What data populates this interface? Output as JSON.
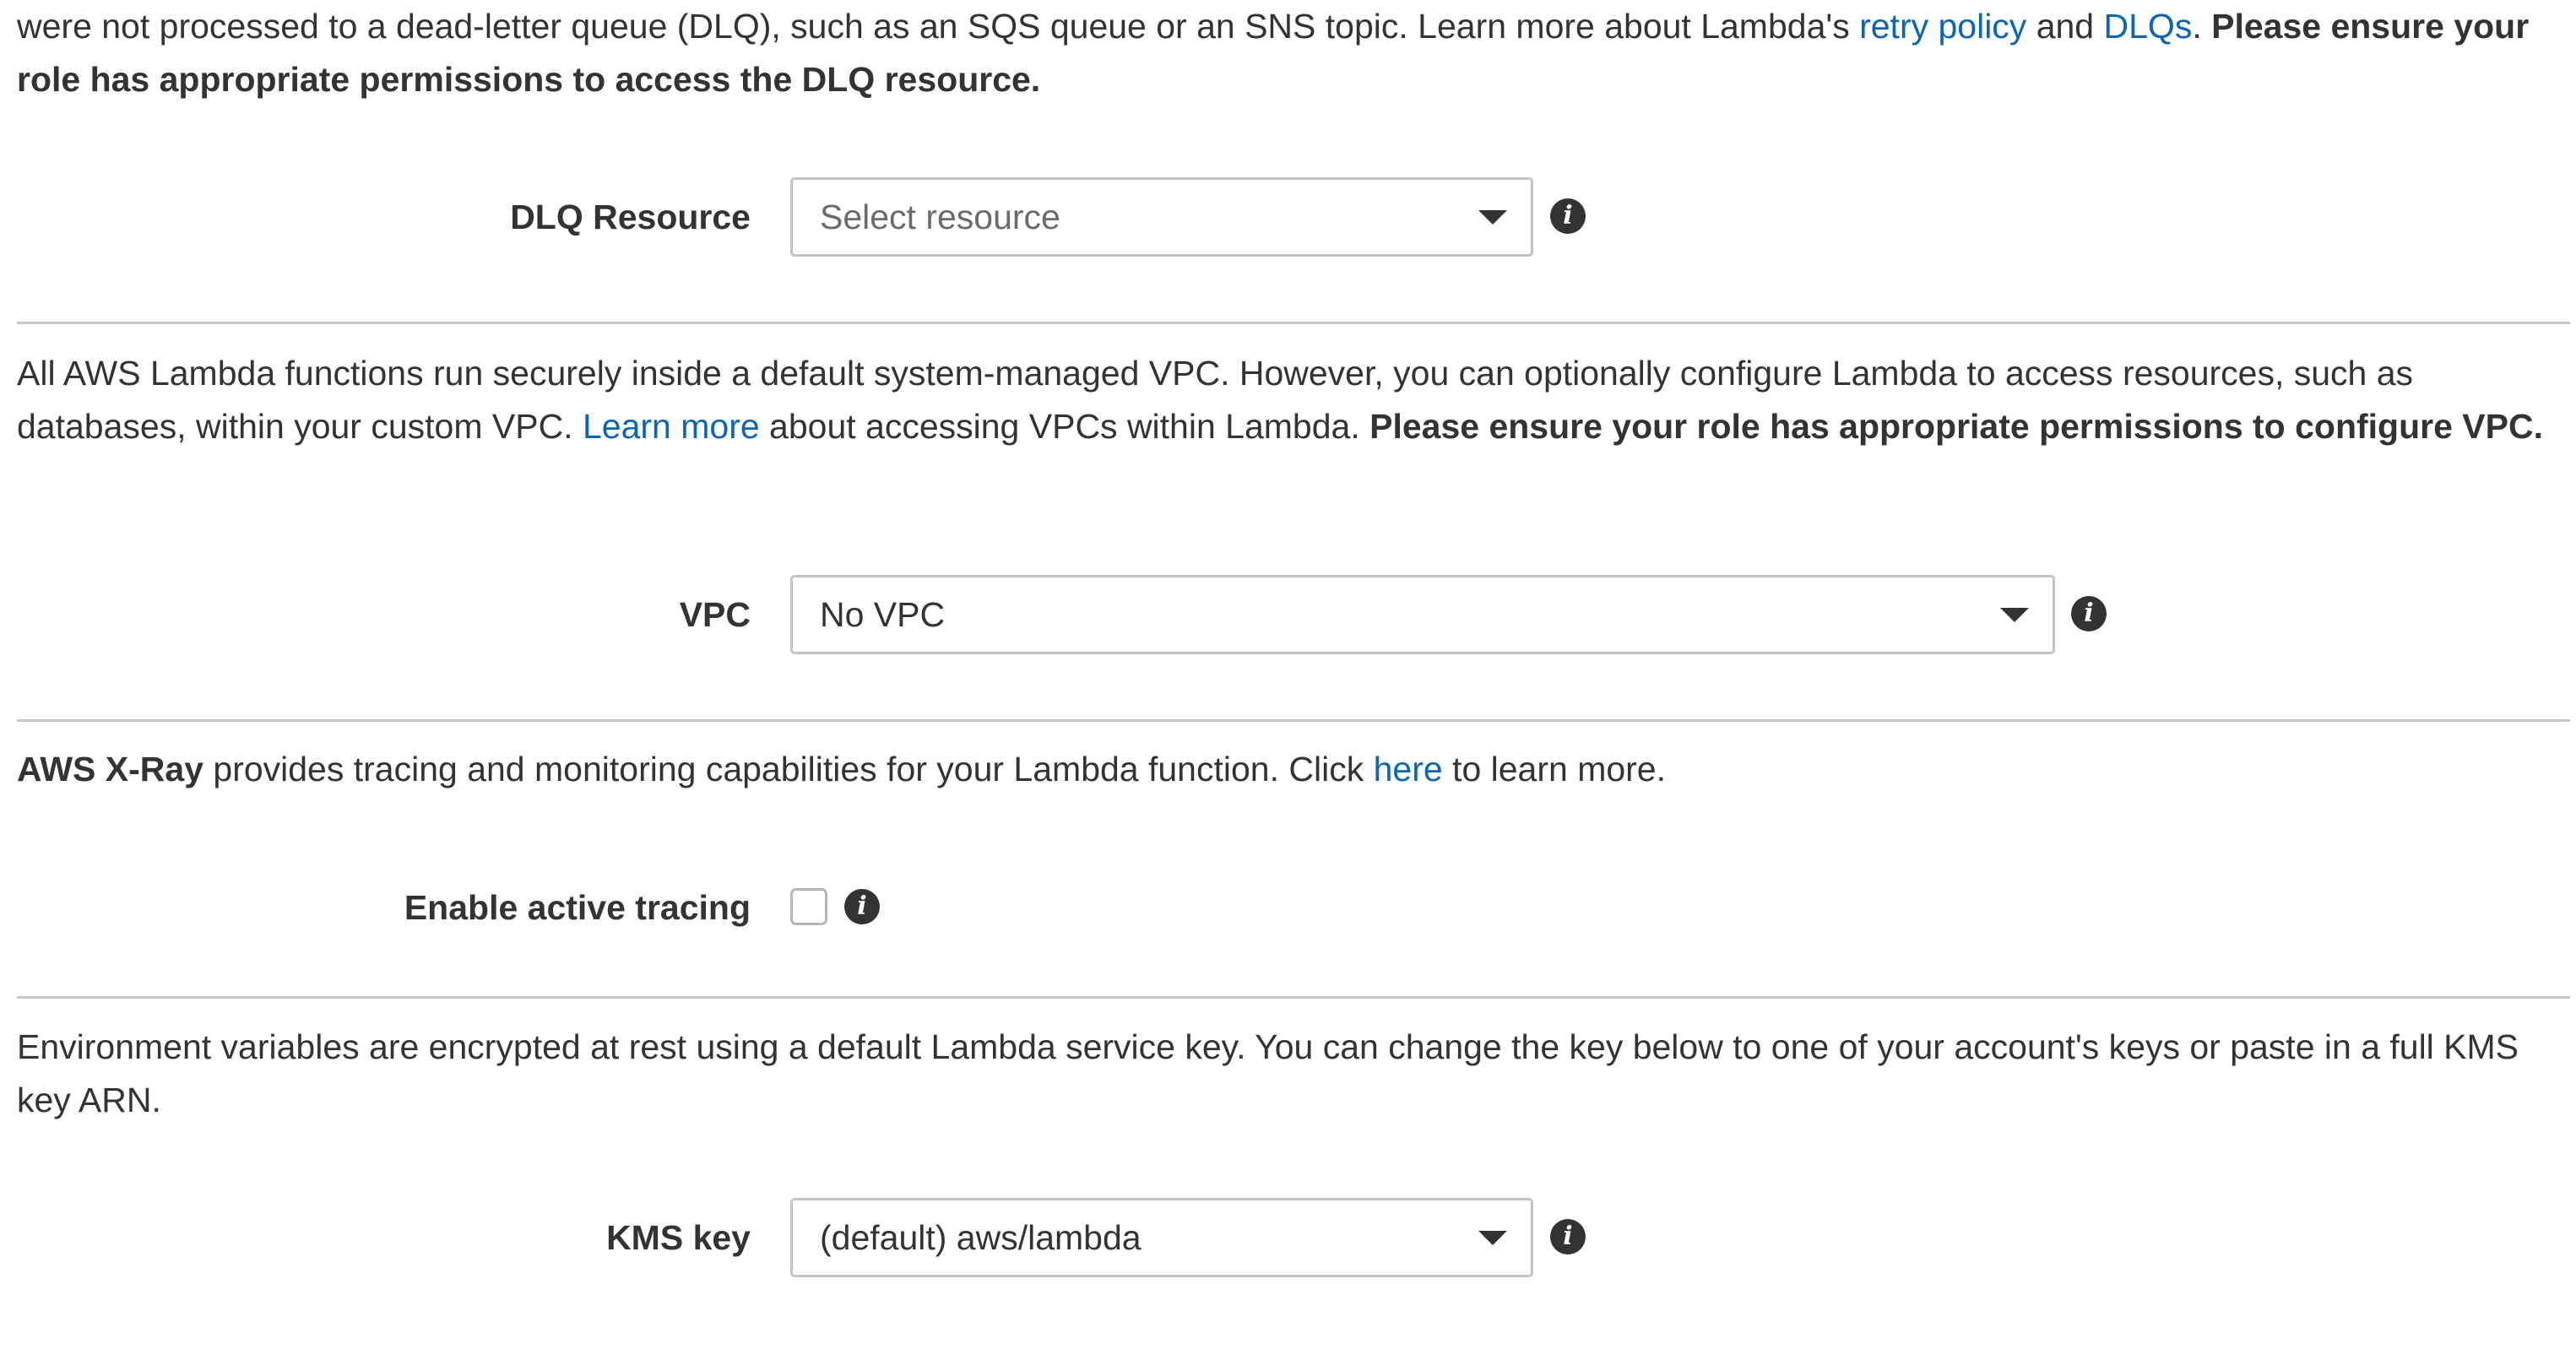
{
  "dlq_section": {
    "description": {
      "text_1": "were not processed to a dead-letter queue (DLQ), such as an SQS queue or an SNS topic. Learn more about Lambda's ",
      "link_retry": "retry policy",
      "text_2": " and ",
      "link_dlqs": "DLQs",
      "text_3": ". ",
      "bold": "Please ensure your role has appropriate permissions to access the DLQ resource."
    },
    "field_label": "DLQ Resource",
    "select_placeholder": "Select resource"
  },
  "vpc_section": {
    "description": {
      "text_1": "All AWS Lambda functions run securely inside a default system-managed VPC. However, you can optionally configure Lambda to access resources, such as databases, within your custom VPC. ",
      "link_learn_more": "Learn more",
      "text_2": " about accessing VPCs within Lambda. ",
      "bold": "Please ensure your role has appropriate permissions to configure VPC."
    },
    "field_label": "VPC",
    "select_value": "No VPC"
  },
  "xray_section": {
    "description": {
      "bold": "AWS X-Ray",
      "text_1": " provides tracing and monitoring capabilities for your Lambda function. Click ",
      "link_here": "here",
      "text_2": " to learn more."
    },
    "field_label": "Enable active tracing",
    "checkbox_checked": false
  },
  "kms_section": {
    "description": "Environment variables are encrypted at rest using a default Lambda service key. You can change the key below to one of your account's keys or paste in a full KMS key ARN.",
    "field_label": "KMS key",
    "select_value": "(default) aws/lambda"
  },
  "icons": {
    "info_glyph": "i",
    "info_icon_name": "info-icon",
    "caret_icon_name": "caret-down-icon"
  },
  "colors": {
    "link": "#0b64b5",
    "text": "#333333",
    "divider": "#c9c9c9",
    "border": "#c4c4c4"
  }
}
